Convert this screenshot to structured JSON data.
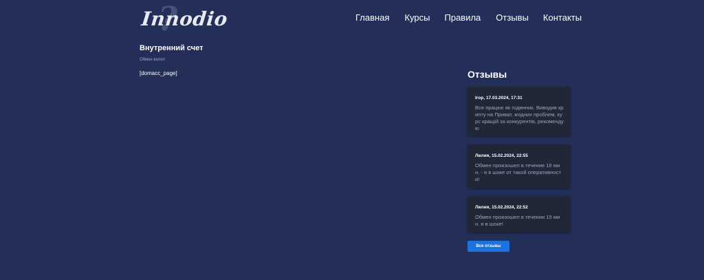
{
  "logo": {
    "text": "Innodio",
    "mark": "?"
  },
  "nav": {
    "items": [
      {
        "label": "Главная"
      },
      {
        "label": "Курсы"
      },
      {
        "label": "Правила"
      },
      {
        "label": "Отзывы"
      },
      {
        "label": "Контакты"
      }
    ]
  },
  "main": {
    "title": "Внутренний счет",
    "breadcrumb": "Обмен валют",
    "shortcode": "[domacc_page]"
  },
  "reviews": {
    "title": "Отзывы",
    "items": [
      {
        "author_date": "Ігор, 17.03.2024, 17:31",
        "text": "Все працює як годинник. Виводив крипту на Приват, жодних проблем, курс кращій за конкурентів, рекомендую"
      },
      {
        "author_date": "Лилия, 15.02.2024, 22:55",
        "text": "Обмен произошел в течение 16 мин. - я в шоке от такой оперативности!"
      },
      {
        "author_date": "Лилия, 15.02.2024, 22:52",
        "text": "Обмен произошел в течении 15 мин. я в шоке!"
      }
    ],
    "all_button": "Все отзывы"
  },
  "colors": {
    "background": "#232f58",
    "card": "#222738",
    "button": "#1a73e0"
  }
}
